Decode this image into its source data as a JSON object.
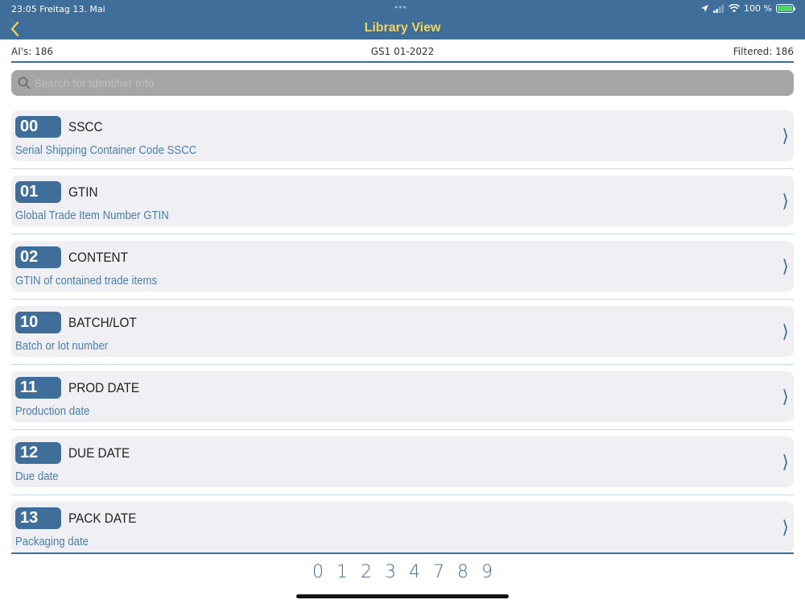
{
  "status_bar": {
    "time_date": "23:05   Freitag 13. Mai",
    "battery": "100 %",
    "icons": [
      "location-icon",
      "signal-icon",
      "wifi-icon",
      "battery-icon"
    ]
  },
  "nav": {
    "title": "Library View"
  },
  "info": {
    "ais": "AI's: 186",
    "version": "GS1 01-2022",
    "filtered": "Filtered: 186"
  },
  "search": {
    "placeholder": "Search for Identifier Info",
    "value": ""
  },
  "items": [
    {
      "code": "00",
      "title": "SSCC",
      "desc": "Serial Shipping Container Code SSCC"
    },
    {
      "code": "01",
      "title": "GTIN",
      "desc": "Global Trade Item Number GTIN"
    },
    {
      "code": "02",
      "title": "CONTENT",
      "desc": "GTIN of contained trade items"
    },
    {
      "code": "10",
      "title": "BATCH/LOT",
      "desc": "Batch or lot number"
    },
    {
      "code": "11",
      "title": "PROD DATE",
      "desc": "Production date"
    },
    {
      "code": "12",
      "title": "DUE DATE",
      "desc": "Due date"
    },
    {
      "code": "13",
      "title": "PACK DATE",
      "desc": "Packaging date"
    }
  ],
  "index": [
    "0",
    "1",
    "2",
    "3",
    "4",
    "7",
    "8",
    "9"
  ],
  "colors": {
    "header": "#3e6e99",
    "title": "#f2d35b",
    "card": "#efeff4",
    "desc": "#4a7fa8"
  }
}
